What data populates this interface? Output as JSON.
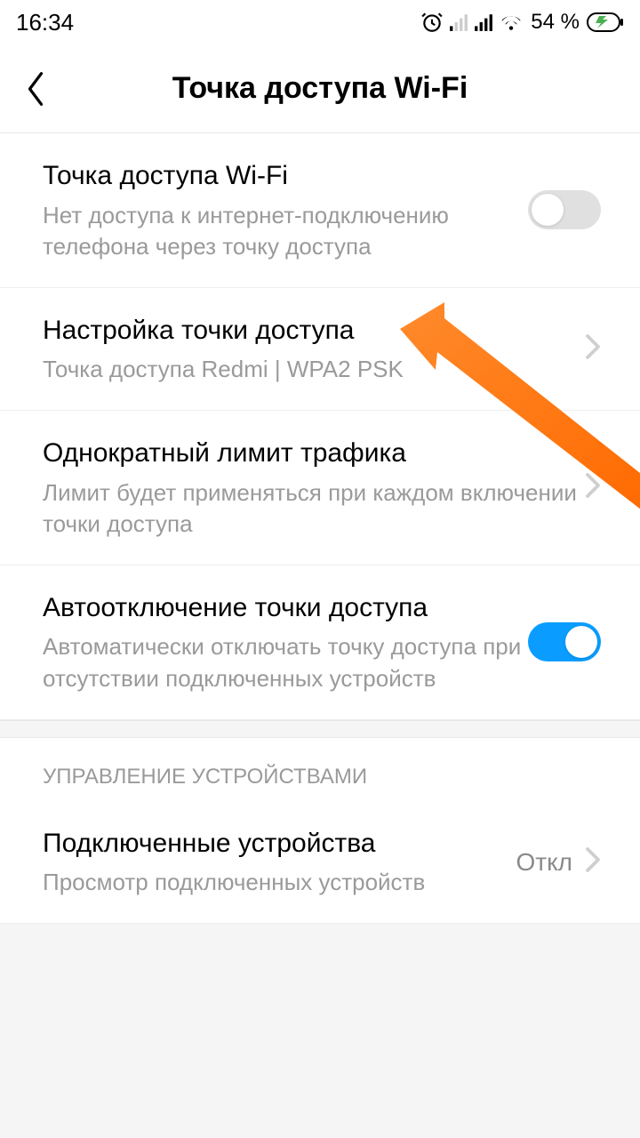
{
  "status": {
    "time": "16:34",
    "battery": "54 %"
  },
  "header": {
    "title": "Точка доступа Wi-Fi"
  },
  "items": {
    "hotspot": {
      "title": "Точка доступа Wi-Fi",
      "sub": "Нет доступа к интернет-подключению телефона через точку доступа"
    },
    "setup": {
      "title": "Настройка точки доступа",
      "sub": "Точка доступа Redmi | WPA2 PSK"
    },
    "limit": {
      "title": "Однократный лимит трафика",
      "sub": "Лимит будет применяться при каждом включении точки доступа"
    },
    "autooff": {
      "title": "Автоотключение точки доступа",
      "sub": "Автоматически отключать точку доступа при отсутствии подключенных устройств"
    },
    "devices": {
      "title": "Подключенные устройства",
      "sub": "Просмотр подключенных устройств",
      "value": "Откл"
    }
  },
  "sections": {
    "devicemanagement": "УПРАВЛЕНИЕ УСТРОЙСТВАМИ"
  },
  "toggles": {
    "hotspot": false,
    "autooff": true
  }
}
